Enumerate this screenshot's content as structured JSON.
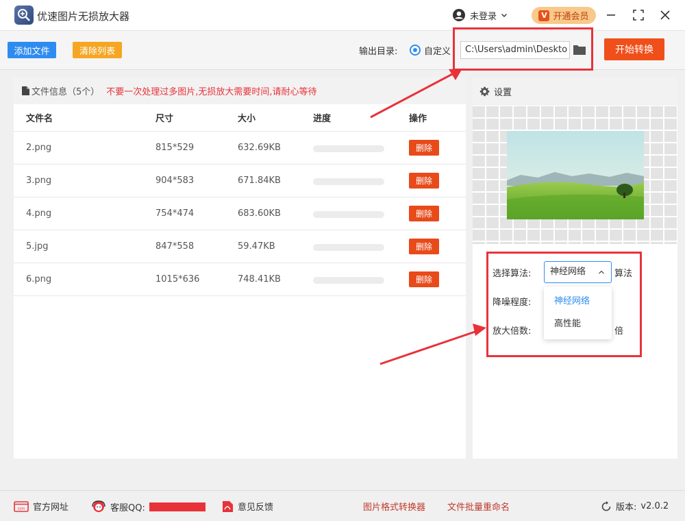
{
  "app": {
    "title": "优速图片无损放大器",
    "login_label": "未登录",
    "vip_label": "开通会员",
    "vip_badge": "V"
  },
  "toolbar": {
    "add_label": "添加文件",
    "clear_label": "清除列表",
    "output_label": "输出目录:",
    "radio_label": "自定义",
    "path_value": "C:\\Users\\admin\\Deskto",
    "start_label": "开始转换"
  },
  "file_panel": {
    "info_label": "文件信息（5个）",
    "warning": "不要一次处理过多图片,无损放大需要时间,请耐心等待",
    "columns": [
      "文件名",
      "尺寸",
      "大小",
      "进度",
      "操作"
    ],
    "rows": [
      {
        "name": "2.png",
        "size": "815*529",
        "filesize": "632.69KB",
        "progress": 0,
        "action": "删除"
      },
      {
        "name": "3.png",
        "size": "904*583",
        "filesize": "671.84KB",
        "progress": 0,
        "action": "删除"
      },
      {
        "name": "4.png",
        "size": "754*474",
        "filesize": "683.60KB",
        "progress": 0,
        "action": "删除"
      },
      {
        "name": "5.jpg",
        "size": "847*558",
        "filesize": "59.47KB",
        "progress": 0,
        "action": "删除"
      },
      {
        "name": "6.png",
        "size": "1015*636",
        "filesize": "748.41KB",
        "progress": 0,
        "action": "删除"
      }
    ]
  },
  "settings": {
    "title": "设置",
    "algo_label": "选择算法:",
    "algo_value": "神经网络",
    "algo_suffix": "算法",
    "denoise_label": "降噪程度:",
    "scale_label": "放大倍数:",
    "scale_suffix": "倍",
    "options": [
      "神经网络",
      "高性能"
    ]
  },
  "footer": {
    "website": "官方网址",
    "qq": "客服QQ:",
    "feedback": "意见反馈",
    "format_converter": "图片格式转换器",
    "batch_rename": "文件批量重命名",
    "version_label": "版本:",
    "version": "v2.0.2"
  },
  "colors": {
    "primary": "#2e8cf0",
    "orange": "#f5a623",
    "danger": "#f04f1a",
    "highlight": "#e8323a"
  }
}
